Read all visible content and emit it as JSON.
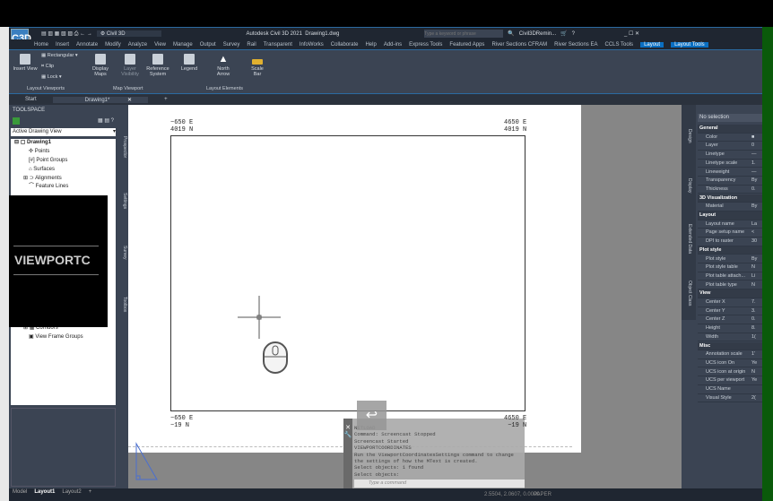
{
  "title_bar": {
    "workspace": "Civil 3D",
    "app_title": "Autodesk Civil 3D 2021",
    "file": "Drawing1.dwg",
    "search_placeholder": "Type a keyword or phrase",
    "user": "Civil3DRemin...",
    "app_logo": "C3D"
  },
  "menu": [
    "Home",
    "Insert",
    "Annotate",
    "Modify",
    "Analyze",
    "View",
    "Manage",
    "Output",
    "Survey",
    "Rail",
    "Transparent",
    "InfoWorks",
    "Collaborate",
    "Help",
    "Add-ins",
    "Express Tools",
    "Featured Apps",
    "River Sections CFRAM",
    "River Sections EA",
    "CCLS Tools",
    "Layout",
    "Layout Tools"
  ],
  "ribbon": {
    "insert_view": "Insert View",
    "rectangular": "Rectangular",
    "clip": "Clip",
    "lock": "Lock",
    "display_maps": "Display Maps",
    "layer_visibility": "Layer Visibility",
    "reference_system": "Reference System",
    "legend": "Legend",
    "north_arrow": "North Arrow",
    "scale_bar": "Scale Bar",
    "panels": [
      "Layout Viewports",
      "Map Viewport",
      "Layout Elements"
    ]
  },
  "doc_tabs": [
    "Start",
    "Drawing1*"
  ],
  "toolspace": {
    "title": "TOOLSPACE",
    "view": "Active Drawing View",
    "tree": [
      "Drawing1",
      "Points",
      "Point Groups",
      "Surfaces",
      "Alignments",
      "Feature Lines"
    ],
    "tree_bottom": [
      "Corridors",
      "View Frame Groups"
    ],
    "vertical_tabs": [
      "Prospector",
      "Settings",
      "Survey",
      "Toolbox"
    ]
  },
  "overlay_text": "VIEWPORTC",
  "viewport": {
    "tl": [
      "−650 E",
      "4019 N"
    ],
    "tr": [
      "4650 E",
      "4019 N"
    ],
    "bl": [
      "−650 E",
      "−19 N"
    ],
    "br": [
      "4650 E",
      "−19 N"
    ]
  },
  "properties": {
    "selection": "No selection",
    "tabs": [
      "Design",
      "Display",
      "Extended Data",
      "Object Class"
    ],
    "rows": [
      {
        "h": "General"
      },
      {
        "k": "Color",
        "v": "■"
      },
      {
        "k": "Layer",
        "v": "0"
      },
      {
        "k": "Linetype",
        "v": "—"
      },
      {
        "k": "Linetype scale",
        "v": "1."
      },
      {
        "k": "Lineweight",
        "v": "—"
      },
      {
        "k": "Transparency",
        "v": "By"
      },
      {
        "k": "Thickness",
        "v": "0."
      },
      {
        "h": "3D Visualization"
      },
      {
        "k": "Material",
        "v": "By"
      },
      {
        "h": "Layout"
      },
      {
        "k": "Layout name",
        "v": "La"
      },
      {
        "k": "Page setup name",
        "v": "<"
      },
      {
        "k": "DPI to raster",
        "v": "30"
      },
      {
        "h": "Plot style"
      },
      {
        "k": "Plot style",
        "v": "By"
      },
      {
        "k": "Plot style table",
        "v": "N"
      },
      {
        "k": "Plot table attach...",
        "v": "Li"
      },
      {
        "k": "Plot table type",
        "v": "N"
      },
      {
        "h": "View"
      },
      {
        "k": "Center X",
        "v": "7."
      },
      {
        "k": "Center Y",
        "v": "3."
      },
      {
        "k": "Center Z",
        "v": "0."
      },
      {
        "k": "Height",
        "v": "8."
      },
      {
        "k": "Width",
        "v": "1("
      },
      {
        "h": "Misc"
      },
      {
        "k": "Annotation scale",
        "v": "1'"
      },
      {
        "k": "UCS icon On",
        "v": "Ye"
      },
      {
        "k": "UCS icon at origin",
        "v": "N"
      },
      {
        "k": "UCS per viewport",
        "v": "Ye"
      },
      {
        "k": "UCS Name",
        "v": ""
      },
      {
        "k": "Visual Style",
        "v": "2("
      }
    ]
  },
  "command": {
    "history": "NETLOAD\nCommand: Screencast Stopped\nScreencast Started\nVIEWPORTCOORDINATES\nRun the ViewportCoordinatesSettings command to change\nthe settings of how the MText is created.\nSelect objects: 1 found\nSelect objects:",
    "placeholder": "Type a command"
  },
  "status": {
    "coords": "2.5504, 2.0607, 0.0000",
    "space": "PAPER",
    "tabs": [
      "Model",
      "Layout1",
      "Layout2",
      "+"
    ]
  }
}
